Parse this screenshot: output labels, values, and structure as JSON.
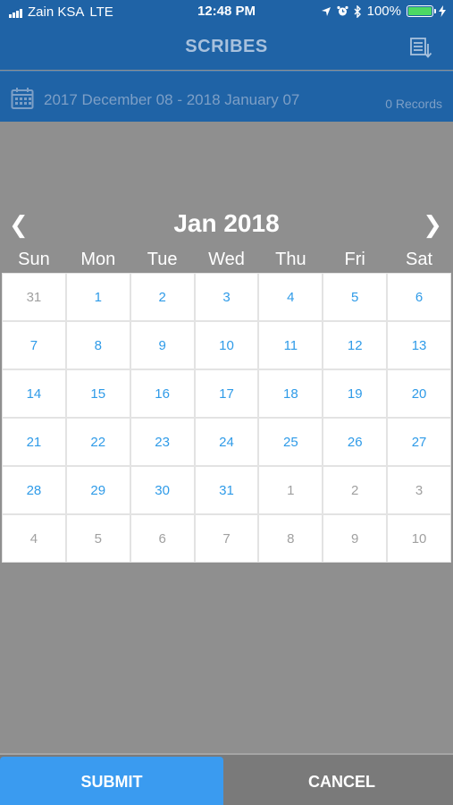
{
  "status_bar": {
    "carrier": "Zain KSA",
    "network": "LTE",
    "time": "12:48 PM",
    "battery": "100%",
    "icons": [
      "signal-bars",
      "location-arrow",
      "alarm-clock",
      "bluetooth",
      "battery-full",
      "charging-bolt"
    ]
  },
  "nav": {
    "title": "SCRIBES",
    "sort_icon": "sort-list-icon"
  },
  "date_bar": {
    "range": "2017 December 08 - 2018 January 07",
    "records": "0 Records",
    "icon": "calendar-icon"
  },
  "calendar": {
    "month_title": "Jan 2018",
    "prev_arrow": "❮",
    "next_arrow": "❯",
    "weekdays": [
      "Sun",
      "Mon",
      "Tue",
      "Wed",
      "Thu",
      "Fri",
      "Sat"
    ],
    "days": [
      {
        "d": "31",
        "in": false
      },
      {
        "d": "1",
        "in": true
      },
      {
        "d": "2",
        "in": true
      },
      {
        "d": "3",
        "in": true
      },
      {
        "d": "4",
        "in": true
      },
      {
        "d": "5",
        "in": true
      },
      {
        "d": "6",
        "in": true
      },
      {
        "d": "7",
        "in": true
      },
      {
        "d": "8",
        "in": true
      },
      {
        "d": "9",
        "in": true
      },
      {
        "d": "10",
        "in": true
      },
      {
        "d": "11",
        "in": true
      },
      {
        "d": "12",
        "in": true
      },
      {
        "d": "13",
        "in": true
      },
      {
        "d": "14",
        "in": true
      },
      {
        "d": "15",
        "in": true
      },
      {
        "d": "16",
        "in": true
      },
      {
        "d": "17",
        "in": true
      },
      {
        "d": "18",
        "in": true
      },
      {
        "d": "19",
        "in": true
      },
      {
        "d": "20",
        "in": true
      },
      {
        "d": "21",
        "in": true
      },
      {
        "d": "22",
        "in": true
      },
      {
        "d": "23",
        "in": true
      },
      {
        "d": "24",
        "in": true
      },
      {
        "d": "25",
        "in": true
      },
      {
        "d": "26",
        "in": true
      },
      {
        "d": "27",
        "in": true
      },
      {
        "d": "28",
        "in": true
      },
      {
        "d": "29",
        "in": true
      },
      {
        "d": "30",
        "in": true
      },
      {
        "d": "31",
        "in": true
      },
      {
        "d": "1",
        "in": false
      },
      {
        "d": "2",
        "in": false
      },
      {
        "d": "3",
        "in": false
      },
      {
        "d": "4",
        "in": false
      },
      {
        "d": "5",
        "in": false
      },
      {
        "d": "6",
        "in": false
      },
      {
        "d": "7",
        "in": false
      },
      {
        "d": "8",
        "in": false
      },
      {
        "d": "9",
        "in": false
      },
      {
        "d": "10",
        "in": false
      }
    ]
  },
  "footer": {
    "submit_label": "SUBMIT",
    "cancel_label": "CANCEL"
  },
  "colors": {
    "header_blue": "#1f63a6",
    "overlay_gray": "#8f8f8f",
    "day_blue": "#2f9be8",
    "day_gray": "#a0a0a0",
    "submit_blue": "#3a9bf0"
  }
}
